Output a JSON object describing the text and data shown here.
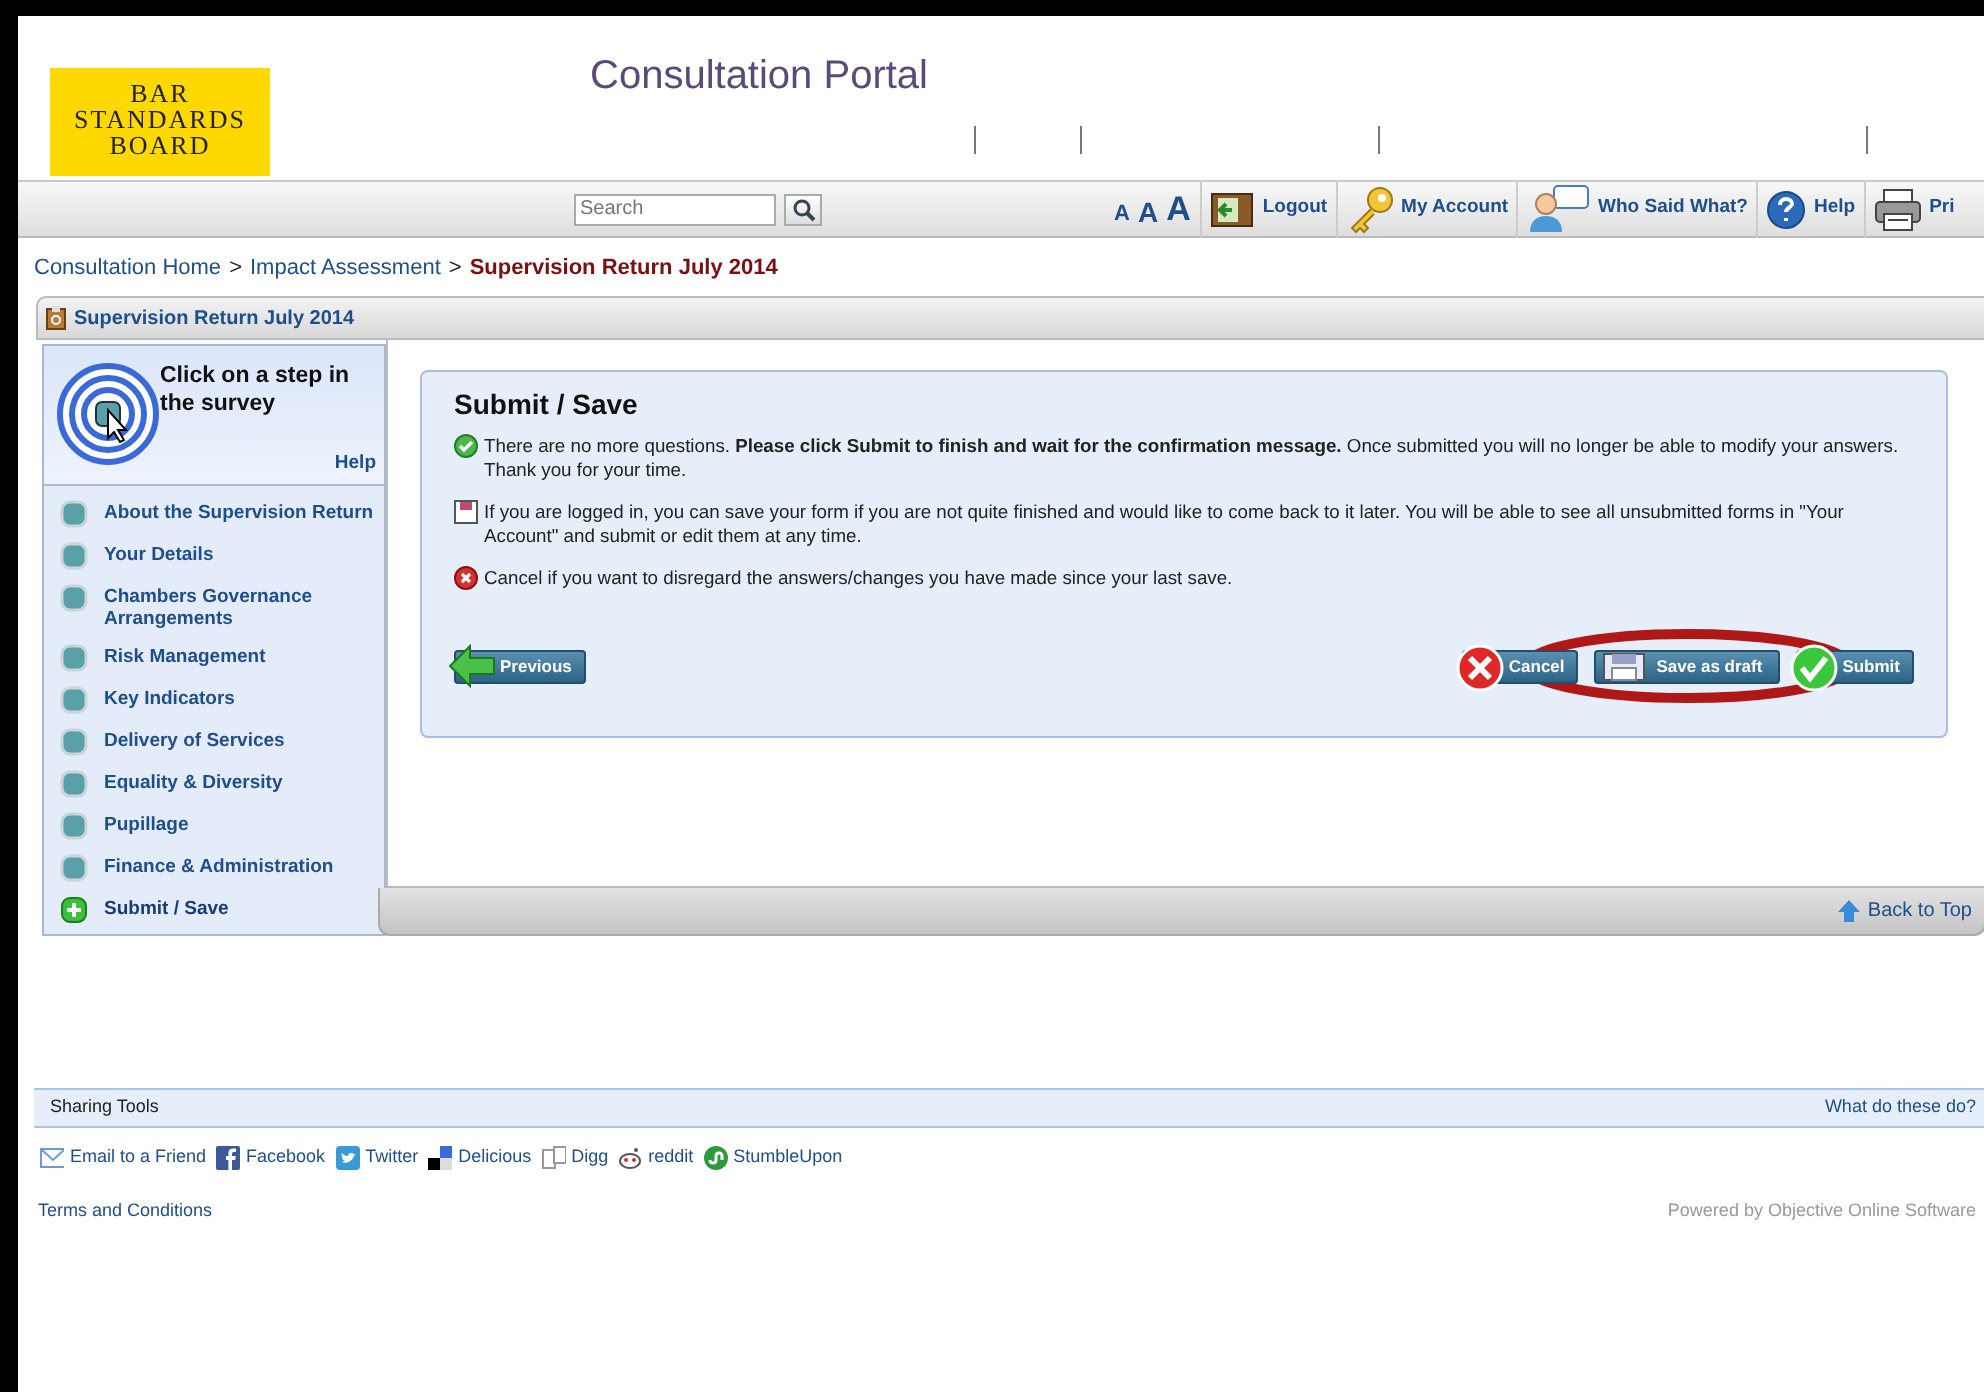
{
  "logo": {
    "lines": [
      "BAR",
      "STANDARDS",
      "BOARD"
    ]
  },
  "portal_title": "Consultation Portal",
  "search": {
    "placeholder": "Search"
  },
  "text_size": [
    "A",
    "A",
    "A"
  ],
  "toolbar": [
    {
      "kind": "logout",
      "label": "Logout"
    },
    {
      "kind": "account",
      "label": "My Account"
    },
    {
      "kind": "chat",
      "label": "Who Said What?"
    },
    {
      "kind": "help",
      "label": "Help"
    },
    {
      "kind": "print",
      "label": "Pri"
    }
  ],
  "breadcrumb_separator": ">",
  "breadcrumb": [
    {
      "label": "Consultation Home",
      "current": false
    },
    {
      "label": "Impact Assessment",
      "current": false
    },
    {
      "label": "Supervision Return July 2014",
      "current": true
    }
  ],
  "panel_title": "Supervision Return July 2014",
  "sidebar": {
    "prompt": "Click on a step in the survey",
    "help": "Help",
    "steps": [
      {
        "label": "About the Supervision Return",
        "selected": false
      },
      {
        "label": "Your Details",
        "selected": false
      },
      {
        "label": "Chambers Governance Arrangements",
        "selected": false
      },
      {
        "label": "Risk Management",
        "selected": false
      },
      {
        "label": "Key Indicators",
        "selected": false
      },
      {
        "label": "Delivery of Services",
        "selected": false
      },
      {
        "label": "Equality & Diversity",
        "selected": false
      },
      {
        "label": "Pupillage",
        "selected": false
      },
      {
        "label": "Finance & Administration",
        "selected": false
      },
      {
        "label": "Submit / Save",
        "selected": true
      }
    ]
  },
  "content": {
    "heading": "Submit / Save",
    "notes": [
      {
        "kind": "ok",
        "text": "There are no more questions. **Please click Submit to finish and wait for the confirmation message.** Once submitted you will no longer be able to modify your answers. Thank you for your time."
      },
      {
        "kind": "save",
        "text": "If you are logged in, you can save your form if you are not quite finished and would like to come back to it later. You will be able to see all unsubmitted forms in \"Your Account\" and submit or edit them at any time."
      },
      {
        "kind": "cancel",
        "text": "Cancel if you want to disregard the answers/changes you have made since your last save."
      }
    ],
    "buttons": [
      {
        "kind": "previous",
        "label": "Previous"
      },
      {
        "kind": "cancel",
        "label": "Cancel"
      },
      {
        "kind": "save",
        "label": "Save as draft"
      },
      {
        "kind": "submit",
        "label": "Submit"
      }
    ],
    "back_to_top": "Back to Top"
  },
  "sharing": {
    "title": "Sharing Tools",
    "help": "What do these do?",
    "links": [
      {
        "kind": "email",
        "label": "Email to a Friend"
      },
      {
        "kind": "facebook",
        "label": "Facebook"
      },
      {
        "kind": "twitter",
        "label": "Twitter"
      },
      {
        "kind": "delicious",
        "label": "Delicious"
      },
      {
        "kind": "digg",
        "label": "Digg"
      },
      {
        "kind": "reddit",
        "label": "reddit"
      },
      {
        "kind": "stumble",
        "label": "StumbleUpon"
      }
    ]
  },
  "footer": {
    "terms": "Terms and Conditions",
    "powered": "Powered by Objective Online Software"
  }
}
